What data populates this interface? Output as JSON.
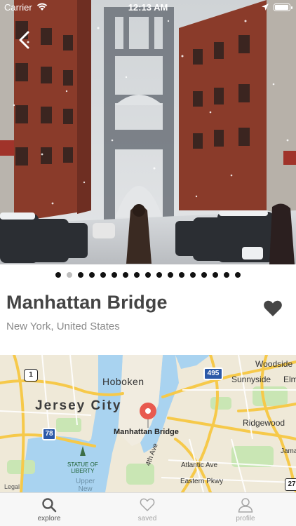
{
  "status_bar": {
    "carrier": "Carrier",
    "time": "12:13 AM",
    "battery_level": 1.0
  },
  "place": {
    "title": "Manhattan Bridge",
    "subtitle": "New York, United States",
    "favorited": true
  },
  "gallery": {
    "page_count": 17,
    "active_index": 1
  },
  "map": {
    "labels": {
      "hoboken": "Hoboken",
      "jersey_city": "Jersey City",
      "pin_label": "Manhattan Bridge",
      "sunnyside": "Sunnyside",
      "woodside": "Woodside",
      "elm": "Elm",
      "ridgewood": "Ridgewood",
      "atlantic": "Atlantic Ave",
      "eastern": "Eastern Pkwy",
      "fourth_ave": "4th Ave",
      "statue_line1": "STATUE OF",
      "statue_line2": "LIBERTY",
      "upper_line1": "Upper",
      "upper_line2": "New",
      "jamaica": "Jama"
    },
    "shields": {
      "i495": "495",
      "i78": "78",
      "us1": "1",
      "r27": "27"
    },
    "legal": "Legal",
    "pin_color": "#e85a4f",
    "water_color": "#a9d3f0",
    "park_color": "#c9e6b4",
    "highway_color": "#f6c94a"
  },
  "tabs": [
    {
      "id": "explore",
      "label": "explore",
      "icon": "search-icon",
      "active": true
    },
    {
      "id": "saved",
      "label": "saved",
      "icon": "heart-icon",
      "active": false
    },
    {
      "id": "profile",
      "label": "profile",
      "icon": "user-icon",
      "active": false
    }
  ]
}
